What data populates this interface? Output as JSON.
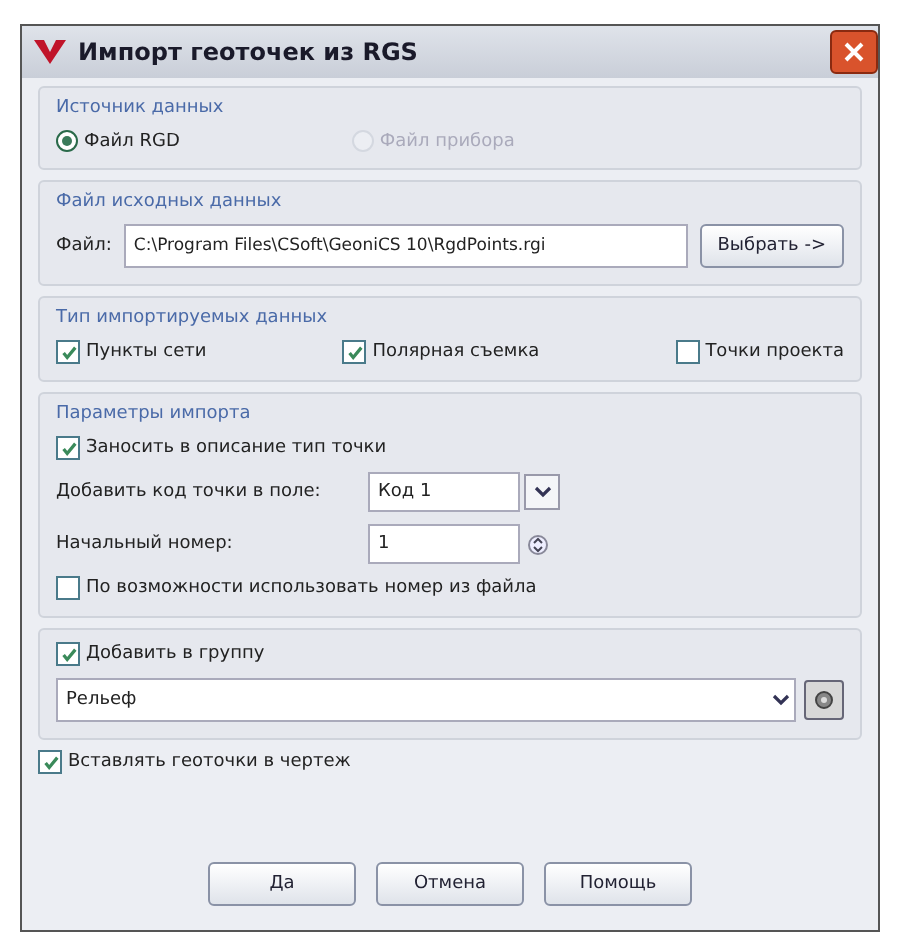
{
  "window": {
    "title": "Импорт геоточек из RGS"
  },
  "source": {
    "title": "Источник данных",
    "radios": [
      {
        "label": "Файл RGD",
        "selected": true,
        "disabled": false
      },
      {
        "label": "Файл прибора",
        "selected": false,
        "disabled": true
      }
    ]
  },
  "file": {
    "title": "Файл исходных данных",
    "label": "Файл:",
    "value": "C:\\Program Files\\CSoft\\GeoniCS 10\\RgdPoints.rgi",
    "button": "Выбрать ->"
  },
  "types": {
    "title": "Тип импортируемых данных",
    "items": [
      {
        "label": "Пункты сети",
        "checked": true
      },
      {
        "label": "Полярная съемка",
        "checked": true
      },
      {
        "label": "Точки проекта",
        "checked": false
      }
    ]
  },
  "params": {
    "title": "Параметры импорта",
    "rows": [
      {
        "kind": "checkbox",
        "label": "Заносить в описание тип точки",
        "checked": true
      },
      {
        "kind": "select",
        "label": "Добавить код точки в поле:",
        "value": "Код 1"
      },
      {
        "kind": "spin",
        "label": "Начальный номер:",
        "value": "1"
      },
      {
        "kind": "checkbox",
        "label": "По возможности использовать номер из файла",
        "checked": false
      }
    ]
  },
  "group": {
    "label": "Добавить в группу",
    "checked": true,
    "value": "Рельеф"
  },
  "insert": {
    "label": "Вставлять геоточки в чертеж",
    "checked": true
  },
  "buttons": [
    "Да",
    "Отмена",
    "Помощь"
  ]
}
